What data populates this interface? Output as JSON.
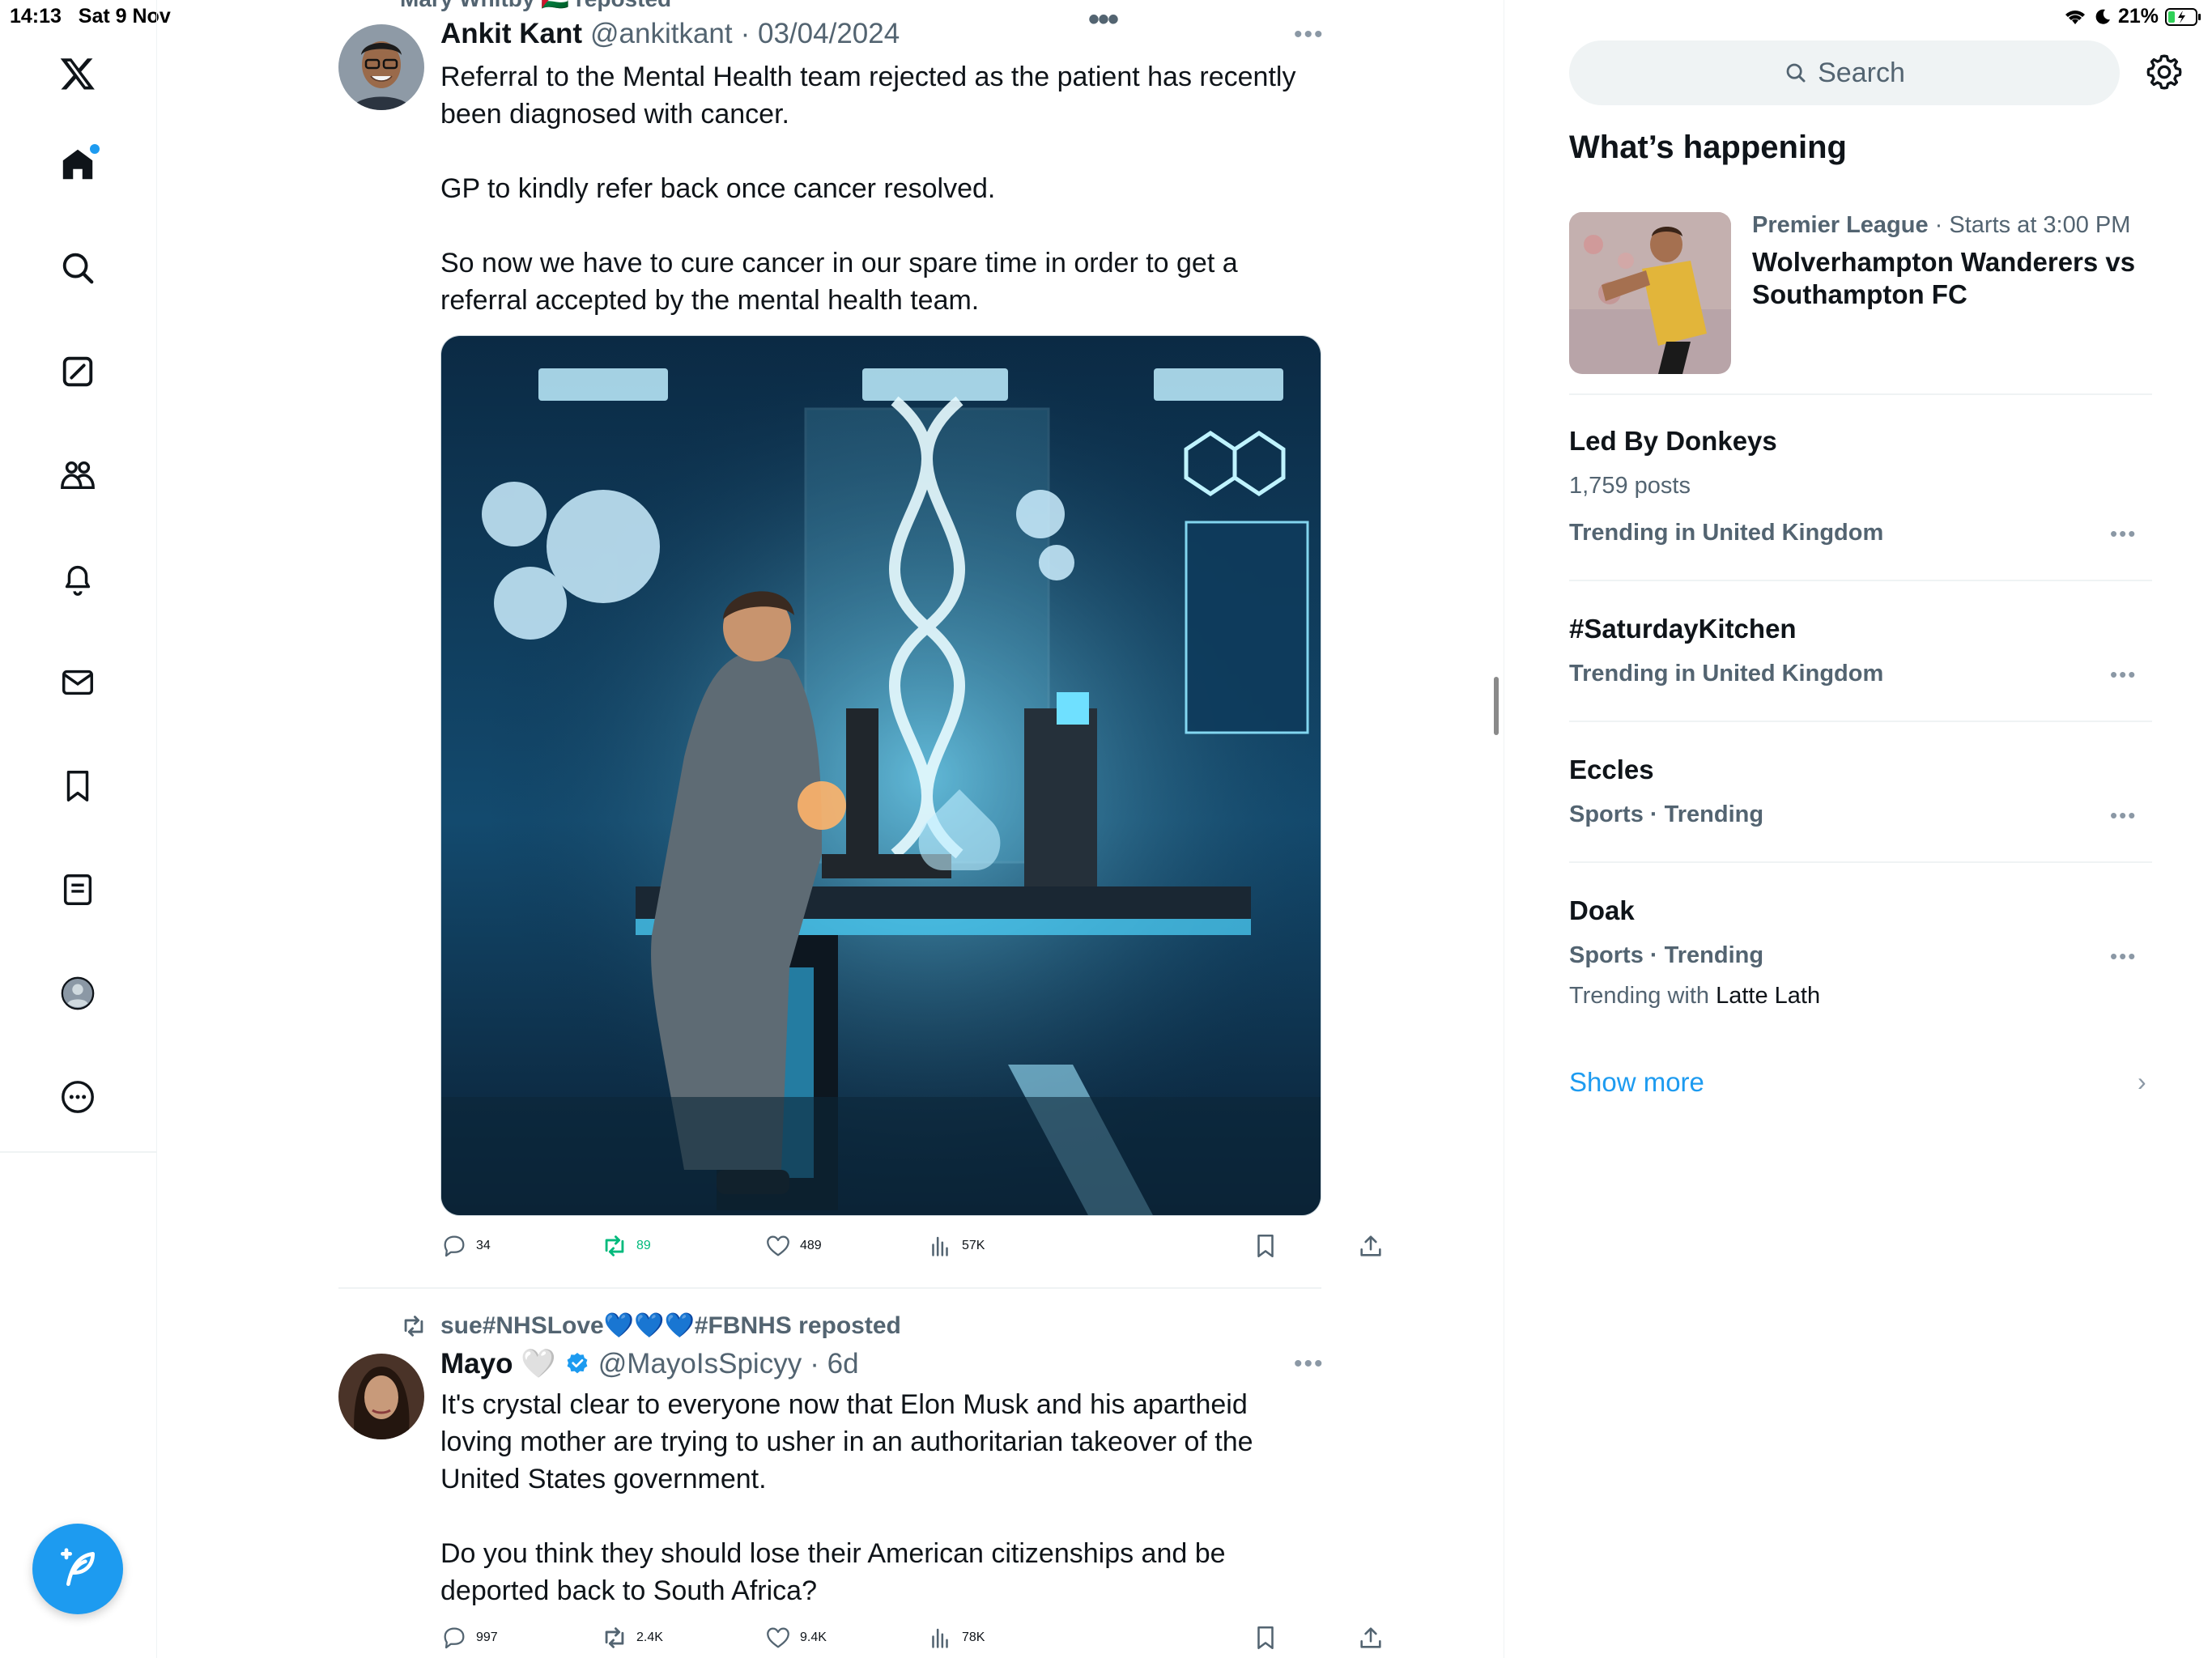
{
  "status_bar": {
    "time": "14:13",
    "date": "Sat 9 Nov",
    "battery": "21%"
  },
  "nav": {
    "items": [
      "x-logo",
      "home",
      "explore",
      "grok",
      "communities",
      "notifications",
      "messages",
      "bookmarks",
      "lists",
      "profile",
      "more"
    ],
    "compose_label": "Post"
  },
  "feed": {
    "top_repost_label": "Mary Whitby 🇵🇸 reposted",
    "tweet1": {
      "name": "Ankit Kant",
      "handle": "@ankitkant",
      "date": "· 03/04/2024",
      "text": "Referral to the Mental Health team rejected as the patient has recently been diagnosed with cancer.\n\nGP to kindly refer back once cancer resolved.\n\nSo now we have to cure cancer in our spare time in order to get a referral accepted by the mental health team.",
      "replies": "34",
      "reposts": "89",
      "likes": "489",
      "views": "57K"
    },
    "tweet2": {
      "reposted_by": "sue#NHSLove💙💙💙#FBNHS reposted",
      "name": "Mayo 🤍",
      "handle": "@MayoIsSpicyy",
      "date": "· 6d",
      "text": "It's crystal clear to everyone now that Elon Musk and his apartheid loving mother are trying to usher in an authoritarian takeover of the United States government.\n\nDo you think they should lose their American citizenships and be deported back to South Africa?",
      "replies": "997",
      "reposts": "2.4K",
      "likes": "9.4K",
      "views": "78K"
    }
  },
  "sidebar": {
    "search_placeholder": "Search",
    "section_title": "What’s happening",
    "event": {
      "category": "Premier League",
      "time": "· Starts at 3:00 PM",
      "title": "Wolverhampton Wanderers vs Southampton FC"
    },
    "trends": [
      {
        "title": "Led By Donkeys",
        "posts": "1,759 posts",
        "context": "Trending in United Kingdom"
      },
      {
        "title": "#SaturdayKitchen",
        "context": "Trending in United Kingdom"
      },
      {
        "title": "Eccles",
        "context": "Sports · Trending"
      },
      {
        "title": "Doak",
        "context": "Sports · Trending",
        "with_prefix": "Trending with",
        "with_name": "Latte Lath"
      }
    ],
    "show_more": "Show more"
  }
}
